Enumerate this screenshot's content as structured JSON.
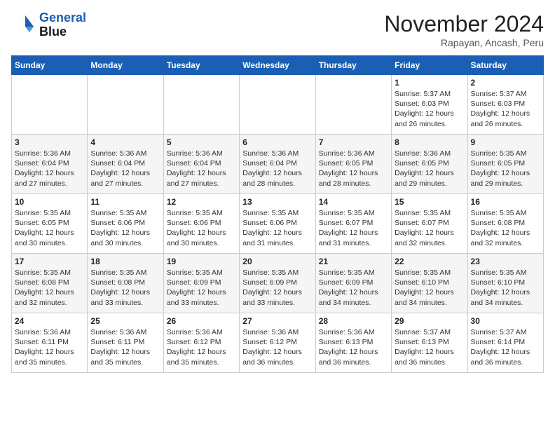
{
  "logo": {
    "line1": "General",
    "line2": "Blue"
  },
  "title": "November 2024",
  "location": "Rapayan, Ancash, Peru",
  "weekdays": [
    "Sunday",
    "Monday",
    "Tuesday",
    "Wednesday",
    "Thursday",
    "Friday",
    "Saturday"
  ],
  "weeks": [
    [
      {
        "day": "",
        "info": ""
      },
      {
        "day": "",
        "info": ""
      },
      {
        "day": "",
        "info": ""
      },
      {
        "day": "",
        "info": ""
      },
      {
        "day": "",
        "info": ""
      },
      {
        "day": "1",
        "info": "Sunrise: 5:37 AM\nSunset: 6:03 PM\nDaylight: 12 hours and 26 minutes."
      },
      {
        "day": "2",
        "info": "Sunrise: 5:37 AM\nSunset: 6:03 PM\nDaylight: 12 hours and 26 minutes."
      }
    ],
    [
      {
        "day": "3",
        "info": "Sunrise: 5:36 AM\nSunset: 6:04 PM\nDaylight: 12 hours and 27 minutes."
      },
      {
        "day": "4",
        "info": "Sunrise: 5:36 AM\nSunset: 6:04 PM\nDaylight: 12 hours and 27 minutes."
      },
      {
        "day": "5",
        "info": "Sunrise: 5:36 AM\nSunset: 6:04 PM\nDaylight: 12 hours and 27 minutes."
      },
      {
        "day": "6",
        "info": "Sunrise: 5:36 AM\nSunset: 6:04 PM\nDaylight: 12 hours and 28 minutes."
      },
      {
        "day": "7",
        "info": "Sunrise: 5:36 AM\nSunset: 6:05 PM\nDaylight: 12 hours and 28 minutes."
      },
      {
        "day": "8",
        "info": "Sunrise: 5:36 AM\nSunset: 6:05 PM\nDaylight: 12 hours and 29 minutes."
      },
      {
        "day": "9",
        "info": "Sunrise: 5:35 AM\nSunset: 6:05 PM\nDaylight: 12 hours and 29 minutes."
      }
    ],
    [
      {
        "day": "10",
        "info": "Sunrise: 5:35 AM\nSunset: 6:05 PM\nDaylight: 12 hours and 30 minutes."
      },
      {
        "day": "11",
        "info": "Sunrise: 5:35 AM\nSunset: 6:06 PM\nDaylight: 12 hours and 30 minutes."
      },
      {
        "day": "12",
        "info": "Sunrise: 5:35 AM\nSunset: 6:06 PM\nDaylight: 12 hours and 30 minutes."
      },
      {
        "day": "13",
        "info": "Sunrise: 5:35 AM\nSunset: 6:06 PM\nDaylight: 12 hours and 31 minutes."
      },
      {
        "day": "14",
        "info": "Sunrise: 5:35 AM\nSunset: 6:07 PM\nDaylight: 12 hours and 31 minutes."
      },
      {
        "day": "15",
        "info": "Sunrise: 5:35 AM\nSunset: 6:07 PM\nDaylight: 12 hours and 32 minutes."
      },
      {
        "day": "16",
        "info": "Sunrise: 5:35 AM\nSunset: 6:08 PM\nDaylight: 12 hours and 32 minutes."
      }
    ],
    [
      {
        "day": "17",
        "info": "Sunrise: 5:35 AM\nSunset: 6:08 PM\nDaylight: 12 hours and 32 minutes."
      },
      {
        "day": "18",
        "info": "Sunrise: 5:35 AM\nSunset: 6:08 PM\nDaylight: 12 hours and 33 minutes."
      },
      {
        "day": "19",
        "info": "Sunrise: 5:35 AM\nSunset: 6:09 PM\nDaylight: 12 hours and 33 minutes."
      },
      {
        "day": "20",
        "info": "Sunrise: 5:35 AM\nSunset: 6:09 PM\nDaylight: 12 hours and 33 minutes."
      },
      {
        "day": "21",
        "info": "Sunrise: 5:35 AM\nSunset: 6:09 PM\nDaylight: 12 hours and 34 minutes."
      },
      {
        "day": "22",
        "info": "Sunrise: 5:35 AM\nSunset: 6:10 PM\nDaylight: 12 hours and 34 minutes."
      },
      {
        "day": "23",
        "info": "Sunrise: 5:35 AM\nSunset: 6:10 PM\nDaylight: 12 hours and 34 minutes."
      }
    ],
    [
      {
        "day": "24",
        "info": "Sunrise: 5:36 AM\nSunset: 6:11 PM\nDaylight: 12 hours and 35 minutes."
      },
      {
        "day": "25",
        "info": "Sunrise: 5:36 AM\nSunset: 6:11 PM\nDaylight: 12 hours and 35 minutes."
      },
      {
        "day": "26",
        "info": "Sunrise: 5:36 AM\nSunset: 6:12 PM\nDaylight: 12 hours and 35 minutes."
      },
      {
        "day": "27",
        "info": "Sunrise: 5:36 AM\nSunset: 6:12 PM\nDaylight: 12 hours and 36 minutes."
      },
      {
        "day": "28",
        "info": "Sunrise: 5:36 AM\nSunset: 6:13 PM\nDaylight: 12 hours and 36 minutes."
      },
      {
        "day": "29",
        "info": "Sunrise: 5:37 AM\nSunset: 6:13 PM\nDaylight: 12 hours and 36 minutes."
      },
      {
        "day": "30",
        "info": "Sunrise: 5:37 AM\nSunset: 6:14 PM\nDaylight: 12 hours and 36 minutes."
      }
    ]
  ]
}
